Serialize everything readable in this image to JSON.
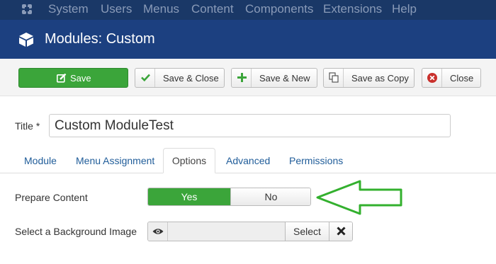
{
  "topnav": {
    "logo_icon": "joomla-logo-icon",
    "menu": [
      "System",
      "Users",
      "Menus",
      "Content",
      "Components",
      "Extensions",
      "Help"
    ]
  },
  "header": {
    "icon": "cube-icon",
    "title": "Modules: Custom"
  },
  "toolbar": {
    "save": "Save",
    "save_close": "Save & Close",
    "save_new": "Save & New",
    "save_copy": "Save as Copy",
    "close": "Close"
  },
  "form": {
    "title_label": "Title *",
    "title_value": "Custom ModuleTest"
  },
  "tabs": [
    "Module",
    "Menu Assignment",
    "Options",
    "Advanced",
    "Permissions"
  ],
  "active_tab": "Options",
  "options": {
    "prepare_content_label": "Prepare Content",
    "prepare_content_yes": "Yes",
    "prepare_content_no": "No",
    "prepare_content_selected": "Yes",
    "background_image_label": "Select a Background Image",
    "background_image_value": "",
    "select_button": "Select"
  },
  "colors": {
    "topnav_bg": "#1a3867",
    "header_bg": "#1c4080",
    "success": "#3ba53a",
    "danger": "#c9302c",
    "annotation_arrow": "#33b02e"
  }
}
